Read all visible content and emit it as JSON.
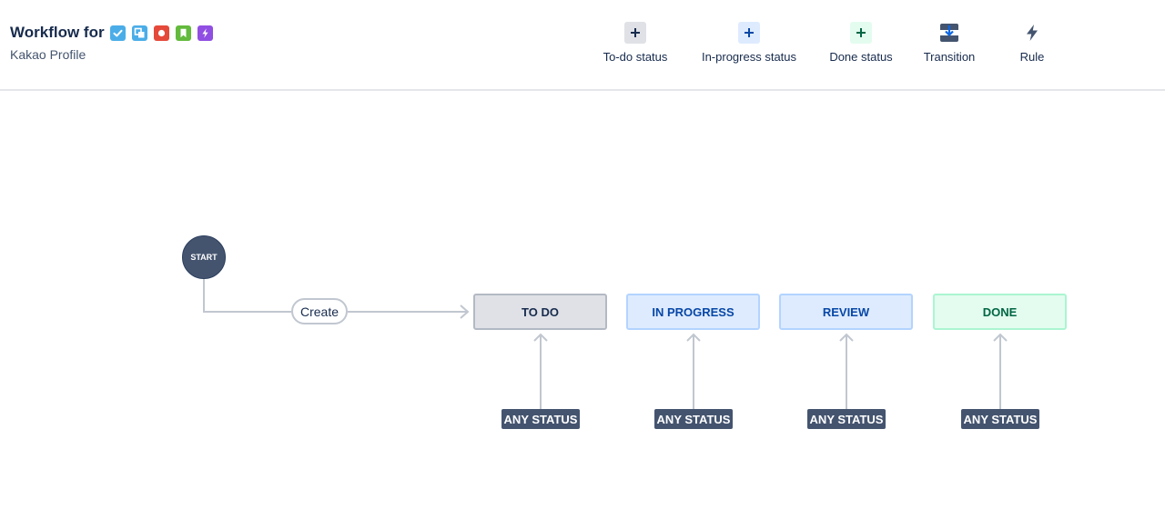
{
  "header": {
    "title": "Workflow for",
    "subtitle": "Kakao Profile",
    "issue_types": [
      {
        "name": "task-icon",
        "color": "#4bade8"
      },
      {
        "name": "subtask-icon",
        "color": "#4bade8"
      },
      {
        "name": "bug-icon",
        "color": "#e5493a"
      },
      {
        "name": "story-icon",
        "color": "#63ba3c"
      },
      {
        "name": "epic-icon",
        "color": "#904ee2"
      }
    ]
  },
  "toolbar": {
    "todo_status": "To-do status",
    "inprogress_status": "In-progress status",
    "done_status": "Done status",
    "transition": "Transition",
    "rule": "Rule"
  },
  "diagram": {
    "start": "START",
    "create": "Create",
    "statuses": [
      {
        "label": "TO DO",
        "category": "todo"
      },
      {
        "label": "IN PROGRESS",
        "category": "inprogress"
      },
      {
        "label": "REVIEW",
        "category": "inprogress"
      },
      {
        "label": "DONE",
        "category": "done"
      }
    ],
    "any_status": "ANY STATUS"
  },
  "colors": {
    "todo_bg": "#dfe1e6",
    "inprogress_bg": "#deebff",
    "done_bg": "#e3fcef",
    "node_dark": "#44546f",
    "connector": "#c1c7d0"
  }
}
